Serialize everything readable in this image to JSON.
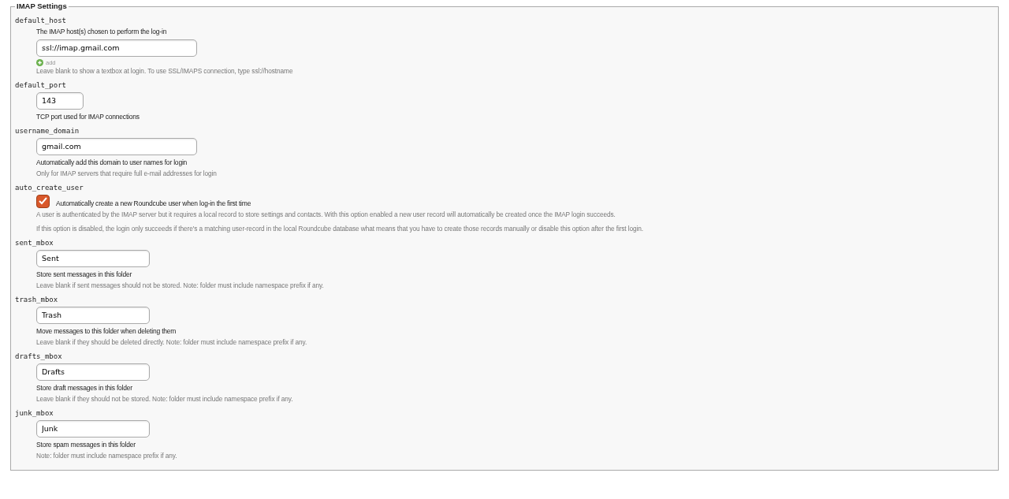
{
  "section": {
    "title": "IMAP Settings"
  },
  "settings": [
    {
      "name": "default_host",
      "kind": "text",
      "description": "The IMAP host(s) chosen to perform the log-in",
      "value": "ssl://imap.gmail.com",
      "add_link": "add",
      "hints": [
        "Leave blank to show a textbox at login. To use SSL/IMAPS connection, type ssl://hostname"
      ]
    },
    {
      "name": "default_port",
      "kind": "port",
      "value": "143",
      "description": "TCP port used for IMAP connections"
    },
    {
      "name": "username_domain",
      "kind": "text",
      "value": "gmail.com",
      "description": "Automatically add this domain to user names for login",
      "hints": [
        "Only for IMAP servers that require full e-mail addresses for login"
      ]
    },
    {
      "name": "auto_create_user",
      "kind": "checkbox",
      "checked": true,
      "description": "Automatically create a new Roundcube user when log-in the first time",
      "hints": [
        "A user is authenticated by the IMAP server but it requires a local record to store settings and contacts. With this option enabled a new user record will automatically be created once the IMAP login succeeds.",
        "If this option is disabled, the login only succeeds if there's a matching user-record in the local Roundcube database what means that you have to create those records manually or disable this option after the first login."
      ]
    },
    {
      "name": "sent_mbox",
      "kind": "folder",
      "value": "Sent",
      "description": "Store sent messages in this folder",
      "hints": [
        "Leave blank if sent messages should not be stored. Note: folder must include namespace prefix if any."
      ]
    },
    {
      "name": "trash_mbox",
      "kind": "folder",
      "value": "Trash",
      "description": "Move messages to this folder when deleting them",
      "hints": [
        "Leave blank if they should be deleted directly. Note: folder must include namespace prefix if any."
      ]
    },
    {
      "name": "drafts_mbox",
      "kind": "folder",
      "value": "Drafts",
      "description": "Store draft messages in this folder",
      "hints": [
        "Leave blank if they should not be stored. Note: folder must include namespace prefix if any."
      ]
    },
    {
      "name": "junk_mbox",
      "kind": "folder",
      "value": "Junk",
      "description": "Store spam messages in this folder",
      "hints": [
        "Note: folder must include namespace prefix if any."
      ]
    }
  ]
}
